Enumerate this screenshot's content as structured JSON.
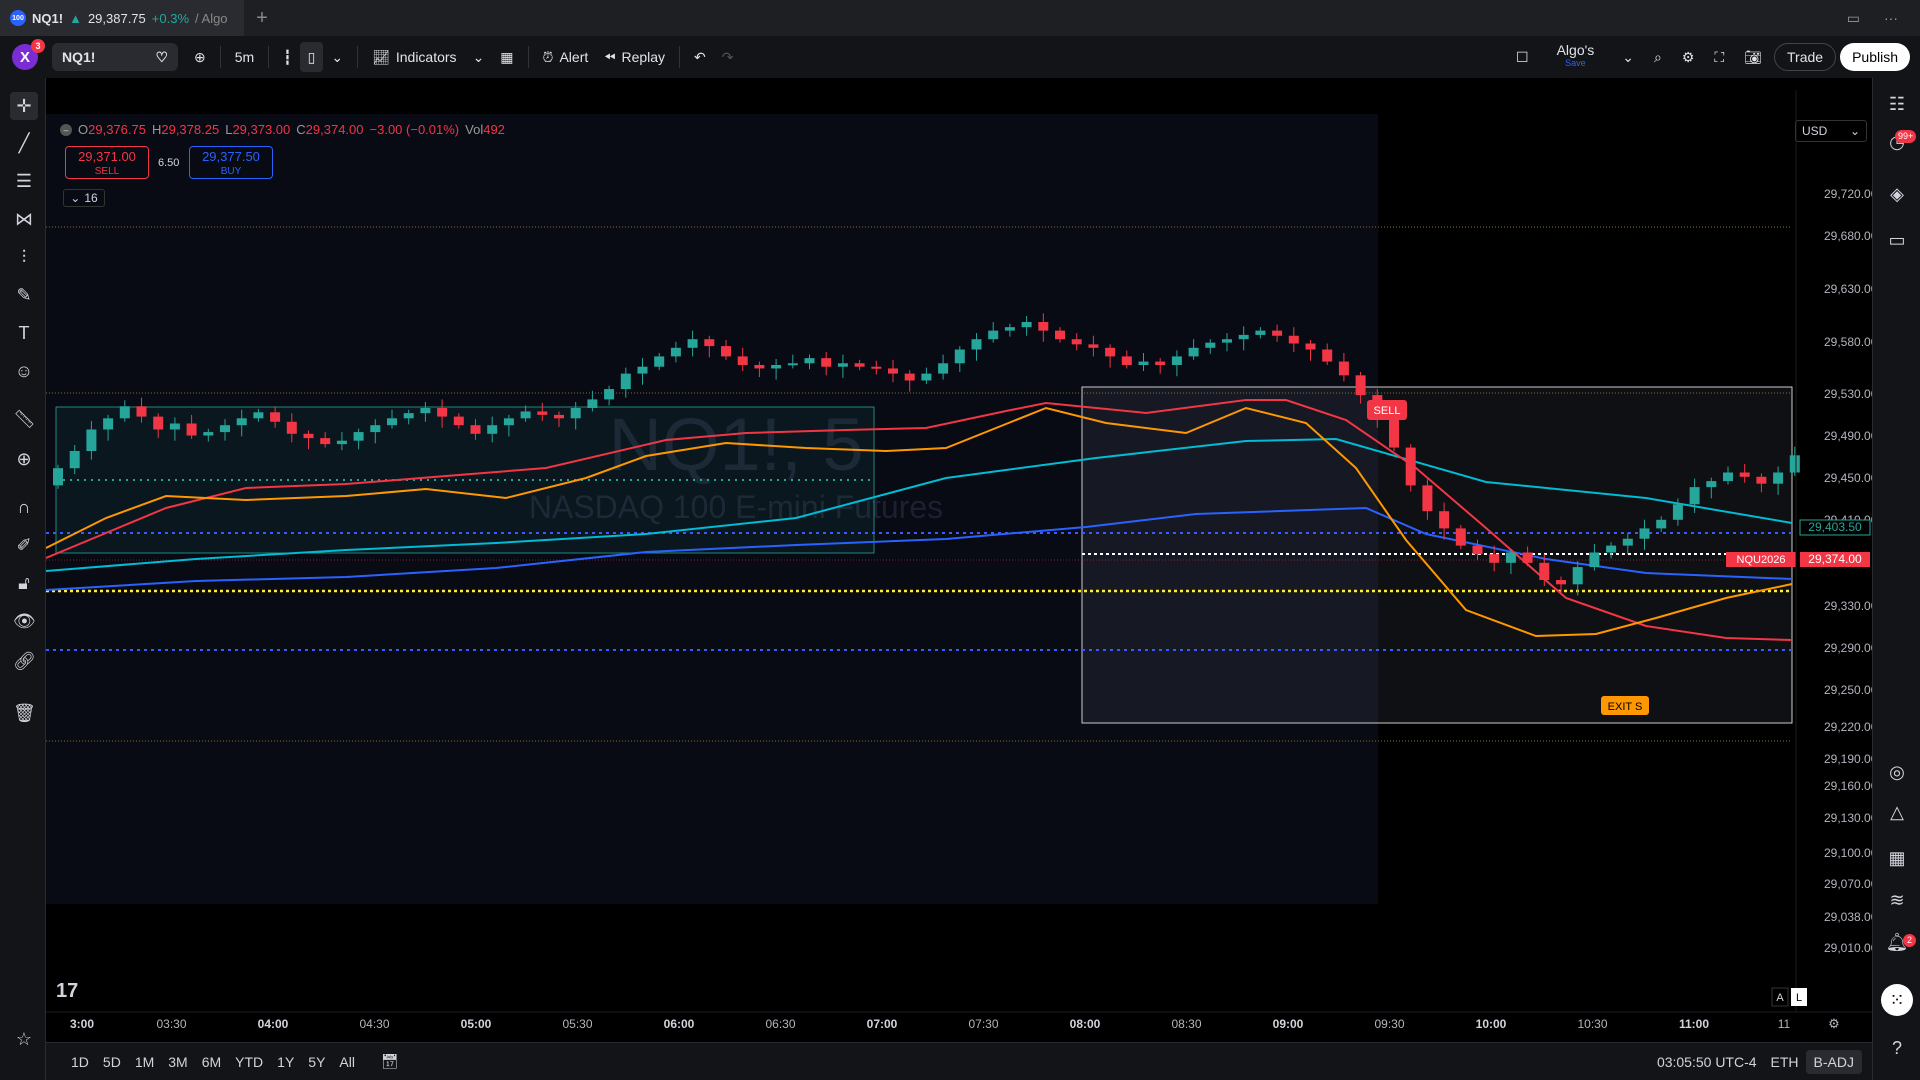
{
  "tab": {
    "symbol": "NQ1!",
    "badge": "100",
    "price": "29,387.75",
    "change": "+0.3%",
    "suffix": "/ Algo"
  },
  "toolbar": {
    "user_initial": "X",
    "user_badge": "3",
    "symbol": "NQ1!",
    "interval": "5m",
    "indicators": "Indicators",
    "alert": "Alert",
    "replay": "Replay",
    "layout_name": "Algo's",
    "layout_sub": "Save",
    "trade": "Trade",
    "publish": "Publish"
  },
  "legend": {
    "o_label": "O",
    "o": "29,376.75",
    "h_label": "H",
    "h": "29,378.25",
    "l_label": "L",
    "l": "29,373.00",
    "c_label": "C",
    "c": "29,374.00",
    "chg": "−3.00 (−0.01%)",
    "vol_label": "Vol",
    "vol": "492"
  },
  "trade_panel": {
    "sell_price": "29,371.00",
    "sell_label": "SELL",
    "spread": "6.50",
    "buy_price": "29,377.50",
    "buy_label": "BUY",
    "collapse_count": "16"
  },
  "currency": "USD",
  "watermark": {
    "symbol": "NQ1!, 5",
    "name": "NASDAQ 100 E-mini Futures"
  },
  "right_badges": {
    "ideas": "99+",
    "alerts": "2"
  },
  "chart_data": {
    "type": "candlestick",
    "y_ticks": [
      "29,720.00",
      "29,680.00",
      "29,630.00",
      "29,580.00",
      "29,530.00",
      "29,490.00",
      "29,450.00",
      "29,410.00",
      "29,330.00",
      "29,290.00",
      "29,250.00",
      "29,220.00",
      "29,190.00",
      "29,160.00",
      "29,130.00",
      "29,100.00",
      "29,070.00",
      "29,038.00",
      "29,010.00"
    ],
    "x_ticks": [
      "3:00",
      "03:30",
      "04:00",
      "04:30",
      "05:00",
      "05:30",
      "06:00",
      "06:30",
      "07:00",
      "07:30",
      "08:00",
      "08:30",
      "09:00",
      "09:30",
      "10:00",
      "10:30",
      "11:00",
      "11"
    ],
    "price_labels": [
      {
        "text": "29,403.50",
        "color": "#26a69a"
      },
      {
        "text": "29,374.00",
        "color": "#f23645"
      },
      {
        "text": "NQU2026",
        "color": "#f23645"
      }
    ],
    "annotations": [
      {
        "text": "SELL",
        "color": "#f23645"
      },
      {
        "text": "EXIT S",
        "color": "#ff9800"
      }
    ]
  },
  "bottom": {
    "ranges": [
      "1D",
      "5D",
      "1M",
      "3M",
      "6M",
      "YTD",
      "1Y",
      "5Y",
      "All"
    ],
    "time": "03:05:50 UTC-4",
    "session": "ETH",
    "adj": "B-ADJ",
    "log_a": "A",
    "log_l": "L"
  }
}
